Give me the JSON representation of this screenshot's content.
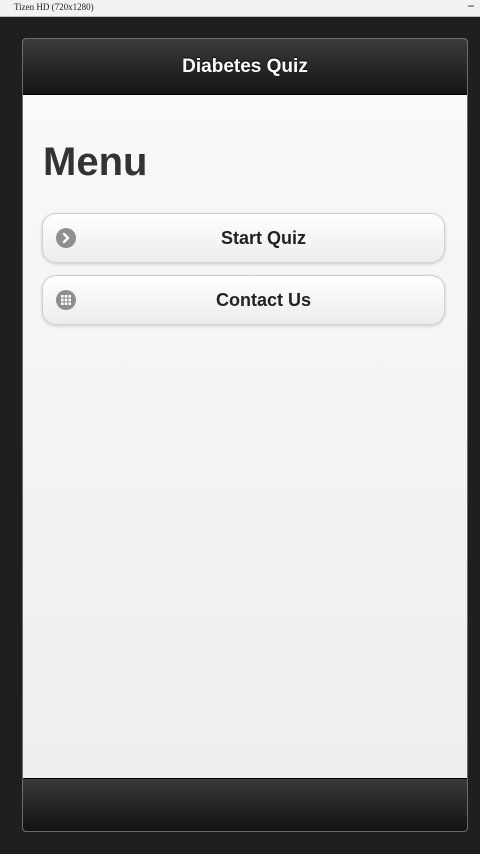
{
  "window": {
    "title": "Tizen HD (720x1280)",
    "minimize_label": "−"
  },
  "header": {
    "title": "Diabetes Quiz"
  },
  "menu": {
    "heading": "Menu",
    "items": [
      {
        "label": "Start Quiz",
        "icon": "arrow-right-circle-icon"
      },
      {
        "label": "Contact Us",
        "icon": "grid-icon"
      }
    ]
  },
  "colors": {
    "header_bg": "#1c1c1c",
    "content_bg": "#f2f2f2",
    "icon_gray": "#8f8f8f"
  }
}
